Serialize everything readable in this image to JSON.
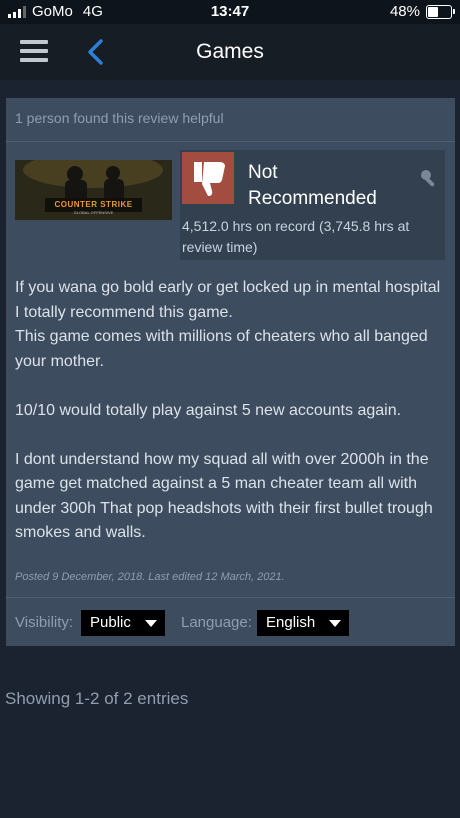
{
  "status_bar": {
    "carrier": "GoMo",
    "network": "4G",
    "time": "13:47",
    "battery": "48%",
    "battery_level": 0.48
  },
  "nav": {
    "title": "Games",
    "menu_icon": "hamburger-icon",
    "back_icon": "chevron-left-icon",
    "back_color": "#2e7fd8"
  },
  "review": {
    "helpful_text": "1 person found this review helpful",
    "game_capsule": {
      "logo_text": "COUNTER STRIKE",
      "sub_text": "GLOBAL OFFENSIVE"
    },
    "recommendation": {
      "title_line1": "Not",
      "title_line2": "Recommended",
      "icon": "thumbs-down-icon",
      "icon_bg": "#a34c40",
      "award_icon": "award-icon"
    },
    "hours_text": "4,512.0 hrs on record (3,745.8 hrs at review time)",
    "body": {
      "p1": "If you wana go bold early or get locked up in mental hospital I totally recommend this game.",
      "p2": "This game comes with millions of cheaters who all banged your mother.",
      "p3": "10/10 would totally play against 5 new accounts again.",
      "p4": "I dont understand how my squad all with over 2000h in the game get matched against a 5 man cheater team all with under 300h That pop headshots with their first bullet trough smokes and walls."
    },
    "posted_text": "Posted 9 December, 2018. Last edited 12 March, 2021.",
    "visibility_label": "Visibility:",
    "visibility_value": "Public",
    "language_label": "Language:",
    "language_value": "English"
  },
  "footer": {
    "showing_text": "Showing 1-2 of 2 entries"
  }
}
